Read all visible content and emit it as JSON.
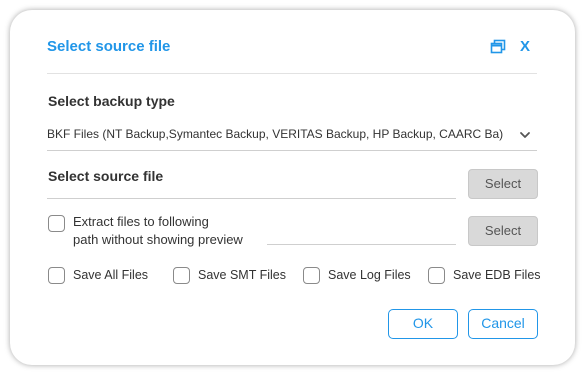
{
  "dialog": {
    "title": "Select source file",
    "accent_color": "#2196e8",
    "close_label": "X"
  },
  "backup_type": {
    "label": "Select backup type",
    "selected": "BKF Files (NT Backup,Symantec Backup, VERITAS Backup, HP Backup, CAARC Ba)"
  },
  "source_file": {
    "label": "Select source file",
    "value": "",
    "button_label": "Select"
  },
  "extract": {
    "label_line1": "Extract files to following",
    "label_line2": "path without showing preview",
    "checked": false,
    "path_value": "",
    "button_label": "Select"
  },
  "save_options": [
    {
      "label": "Save All Files",
      "checked": false
    },
    {
      "label": "Save SMT Files",
      "checked": false
    },
    {
      "label": "Save Log Files",
      "checked": false
    },
    {
      "label": "Save EDB Files",
      "checked": false
    }
  ],
  "footer": {
    "ok_label": "OK",
    "cancel_label": "Cancel"
  },
  "icons": {
    "restore": "restore-window-icon",
    "close": "close-icon",
    "dropdown": "chevron-down-icon"
  }
}
